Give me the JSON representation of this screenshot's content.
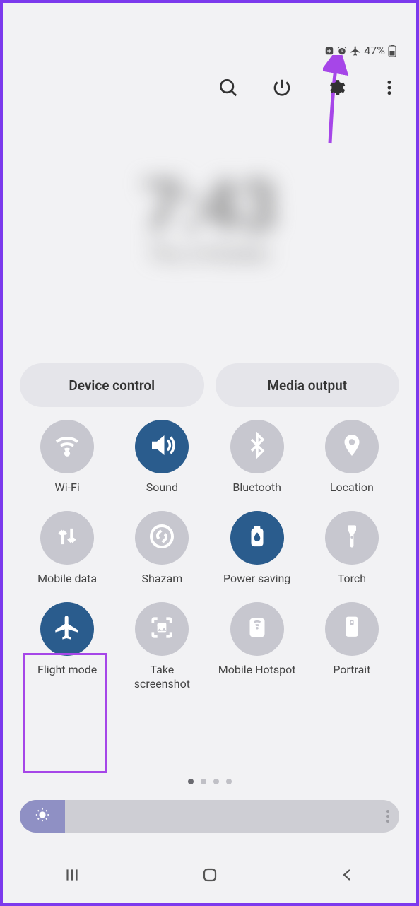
{
  "status": {
    "battery_percent": "47%"
  },
  "clock": {
    "time": "7:43",
    "date": "Thu, 6 October"
  },
  "pills": {
    "device_control": "Device control",
    "media_output": "Media output"
  },
  "tiles": [
    {
      "id": "wifi",
      "label": "Wi-Fi",
      "icon": "wifi",
      "active": false
    },
    {
      "id": "sound",
      "label": "Sound",
      "icon": "sound",
      "active": true
    },
    {
      "id": "bluetooth",
      "label": "Bluetooth",
      "icon": "bluetooth",
      "active": false
    },
    {
      "id": "location",
      "label": "Location",
      "icon": "location",
      "active": false
    },
    {
      "id": "mobile-data",
      "label": "Mobile data",
      "icon": "data",
      "active": false
    },
    {
      "id": "shazam",
      "label": "Shazam",
      "icon": "shazam",
      "active": false
    },
    {
      "id": "power-saving",
      "label": "Power saving",
      "icon": "power",
      "active": true
    },
    {
      "id": "torch",
      "label": "Torch",
      "icon": "torch",
      "active": false
    },
    {
      "id": "flight-mode",
      "label": "Flight mode",
      "icon": "airplane",
      "active": true
    },
    {
      "id": "screenshot",
      "label": "Take screenshot",
      "icon": "screenshot",
      "active": false
    },
    {
      "id": "hotspot",
      "label": "Mobile Hotspot",
      "icon": "hotspot",
      "active": false
    },
    {
      "id": "portrait",
      "label": "Portrait",
      "icon": "portrait",
      "active": false
    }
  ],
  "pager": {
    "total": 4,
    "current": 0
  }
}
